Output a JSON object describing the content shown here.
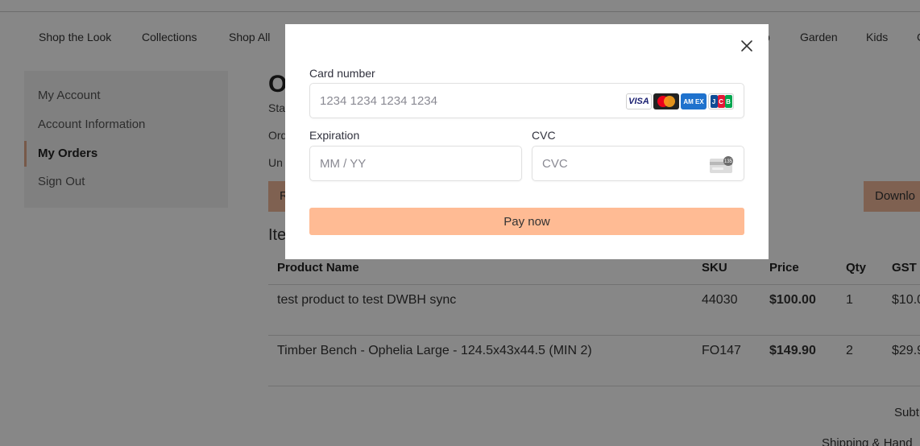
{
  "nav": {
    "items": [
      "Shop the Look",
      "Collections",
      "Shop All",
      "p",
      "Garden",
      "Kids",
      "C"
    ]
  },
  "sidebar": {
    "items": [
      {
        "label": "My Account"
      },
      {
        "label": "Account Information"
      },
      {
        "label": "My Orders"
      },
      {
        "label": "Sign Out"
      }
    ]
  },
  "main": {
    "title": "O",
    "fragments": [
      "Sta",
      "Ord",
      "Un"
    ],
    "left_button_label": "R",
    "download_button_label": "Downlo",
    "items_title": "Ite",
    "table": {
      "headers": [
        "Product Name",
        "SKU",
        "Price",
        "Qty",
        "GST"
      ],
      "rows": [
        {
          "name": "test product to test DWBH sync",
          "sku": "44030",
          "price": "$100.00",
          "qty": "1",
          "gst": "$10.0"
        },
        {
          "name": "Timber Bench - Ophelia Large - 124.5x43x44.5 (MIN 2)",
          "sku": "FO147",
          "price": "$149.90",
          "qty": "2",
          "gst": "$29.9"
        }
      ]
    },
    "summary": {
      "subtotal_label": "Subt",
      "shipping_label": "Shipping & Hand"
    }
  },
  "payment_modal": {
    "card_number_label": "Card number",
    "card_number_placeholder": "1234 1234 1234 1234",
    "brands": [
      "VISA",
      "mastercard",
      "amex",
      "JCB"
    ],
    "brand_icons": [
      "visa-icon",
      "mastercard-icon",
      "amex-icon",
      "jcb-icon"
    ],
    "expiration_label": "Expiration",
    "expiration_placeholder": "MM / YY",
    "cvc_label": "CVC",
    "cvc_placeholder": "CVC",
    "cvc_icon_text": "135",
    "pay_button_label": "Pay now"
  },
  "colors": {
    "overlay": "#000000",
    "pay_button": "#ffbb94",
    "peach_button": "#f0b89a",
    "sidebar_bg": "#f2f2f2",
    "active_marker": "#e0a88a"
  }
}
